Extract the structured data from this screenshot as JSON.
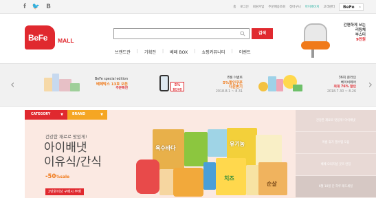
{
  "topbar": {
    "social": [
      "f",
      "🐦",
      "B"
    ],
    "links": [
      "홈",
      "로그인",
      "회원가입",
      "주문배송조회",
      "장바구니",
      "마이페이지",
      "고객센터"
    ],
    "highlight_index": 5,
    "site_select": "BeFe",
    "site_select_icon": "chevron-right-icon"
  },
  "header": {
    "logo": "BeFe",
    "logo_suffix": "MALL",
    "search_placeholder": "",
    "search_button": "검색",
    "nav": [
      "브랜드관",
      "기획전",
      "베페 BOX",
      "쇼핑커뮤니티",
      "이벤트"
    ],
    "promo": {
      "line1": "간편하게 쓰는",
      "line2": "리팅체",
      "line3": "부스터",
      "line4": "9만원"
    }
  },
  "banner_strip": {
    "items": [
      {
        "line1": "BeFe special edition",
        "line2": "베페박스 13호 오픈",
        "line3": "주문특전"
      },
      {
        "line1": "8월 이벤트",
        "line2": "5%할인쿠폰",
        "line3": "다운받기",
        "line4": "2018.8.1 ~ 8.31"
      },
      {
        "line1": "36회 온라인",
        "line2": "베이비페어",
        "line3": "최대 76% 할인",
        "line4": "2018.7.30 ~ 8.26"
      }
    ],
    "badge": {
      "top": "5%",
      "bottom": "할인쿠폰"
    }
  },
  "hero": {
    "category_tab": "CATEGORY",
    "brand_tab": "BRAND",
    "subtitle": "건강한 재료로 맛있게!",
    "title_line1": "아이배냇",
    "title_line2": "이유식/간식",
    "sale_value": "-50",
    "sale_unit": "%sale",
    "tag": "2만원이상 구매시 무배",
    "product_labels": [
      "육수바다",
      "유기농",
      "치즈",
      "순살"
    ],
    "side_menu": [
      "건강한 재료로 맛있게! 아이배냇",
      "여름 휴가 필수템 모음",
      "베페 오리지널 굿즈 런칭",
      "6월 10일 단 하루 레드세일"
    ],
    "active_side_index": 3
  },
  "colors": {
    "brand_red": "#e0292f",
    "brand_orange": "#f5a623",
    "hero_bg": "#fbe9e2",
    "link_highlight": "#2bb3a3"
  }
}
